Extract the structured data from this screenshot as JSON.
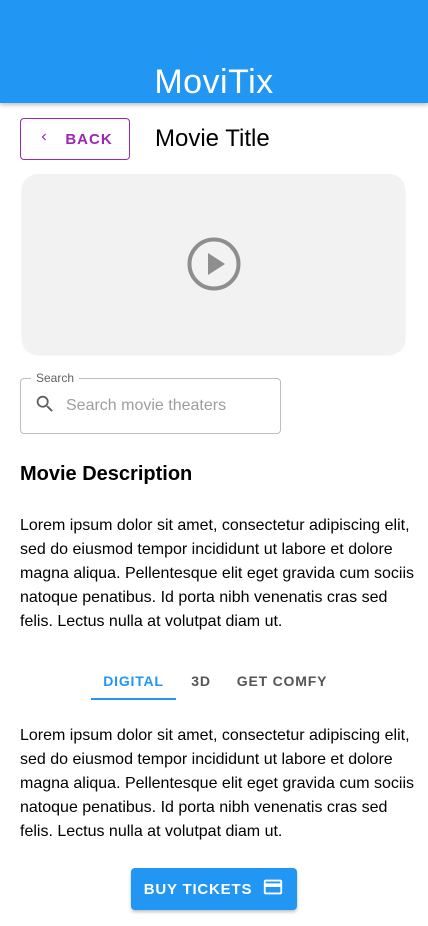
{
  "app_bar": {
    "title": "MoviTix",
    "color": "#2196F3"
  },
  "header": {
    "back_label": "BACK",
    "back_icon": "chevron-left-icon",
    "movie_title": "Movie Title"
  },
  "video": {
    "icon": "play-circle-icon"
  },
  "search": {
    "label": "Search",
    "placeholder": "Search movie theaters",
    "value": "",
    "icon": "search-icon"
  },
  "description": {
    "heading": "Movie Description",
    "text": "Lorem ipsum dolor sit amet, consectetur adipiscing elit, sed do eiusmod tempor incididunt ut labore et dolore magna aliqua. Pellentesque elit eget gravida cum sociis natoque penatibus. Id porta nibh venenatis cras sed felis. Lectus nulla at volutpat diam ut."
  },
  "tabs": [
    {
      "label": "DIGITAL",
      "selected": true
    },
    {
      "label": "3D",
      "selected": false
    },
    {
      "label": "GET COMFY",
      "selected": false
    }
  ],
  "tab_content": {
    "text": "Lorem ipsum dolor sit amet, consectetur adipiscing elit, sed do eiusmod tempor incididunt ut labore et dolore magna aliqua. Pellentesque elit eget gravida cum sociis natoque penatibus. Id porta nibh venenatis cras sed felis. Lectus nulla at volutpat diam ut."
  },
  "buy": {
    "label": "BUY TICKETS",
    "icon": "credit-card-icon"
  },
  "colors": {
    "primary": "#2196F3",
    "secondary": "#9C27B0"
  }
}
